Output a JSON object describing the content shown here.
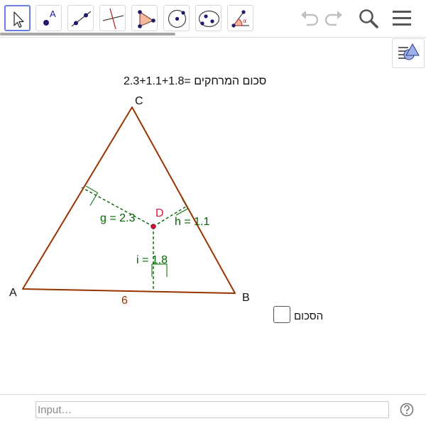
{
  "toolbar": {
    "tools": [
      {
        "name": "move-tool",
        "icon": "arrow-pointer-icon",
        "active": true
      },
      {
        "name": "point-tool",
        "icon": "point-icon"
      },
      {
        "name": "line-tool",
        "icon": "line-icon"
      },
      {
        "name": "perpendicular-line-tool",
        "icon": "perpendicular-icon"
      },
      {
        "name": "polygon-tool",
        "icon": "polygon-icon"
      },
      {
        "name": "circle-tool",
        "icon": "circle-icon"
      },
      {
        "name": "conic-tool",
        "icon": "ellipse-icon"
      },
      {
        "name": "angle-tool",
        "icon": "angle-icon"
      }
    ],
    "point_tool_letter": "A",
    "angle_tool_letter": "α",
    "right": [
      "undo-icon",
      "redo-icon",
      "search-icon",
      "menu-icon"
    ]
  },
  "graphics": {
    "sum_text": "סכום המרחקים =2.3+1.1+1.8",
    "points": {
      "A": "A",
      "B": "B",
      "C": "C",
      "D": "D"
    },
    "distances": {
      "g": "g = 2.3",
      "h": "h = 1.1",
      "i": "i = 1.8"
    },
    "side_length": "6",
    "checkbox_label": "הסכום",
    "checkbox_checked": false
  },
  "input": {
    "placeholder": "Input…",
    "value": ""
  },
  "colors": {
    "triangle": "#993300",
    "distance": "#006400",
    "point_d": "#dc143c",
    "active_tool": "#6a7de4",
    "toolbar_icon": "#1c1c6b"
  }
}
